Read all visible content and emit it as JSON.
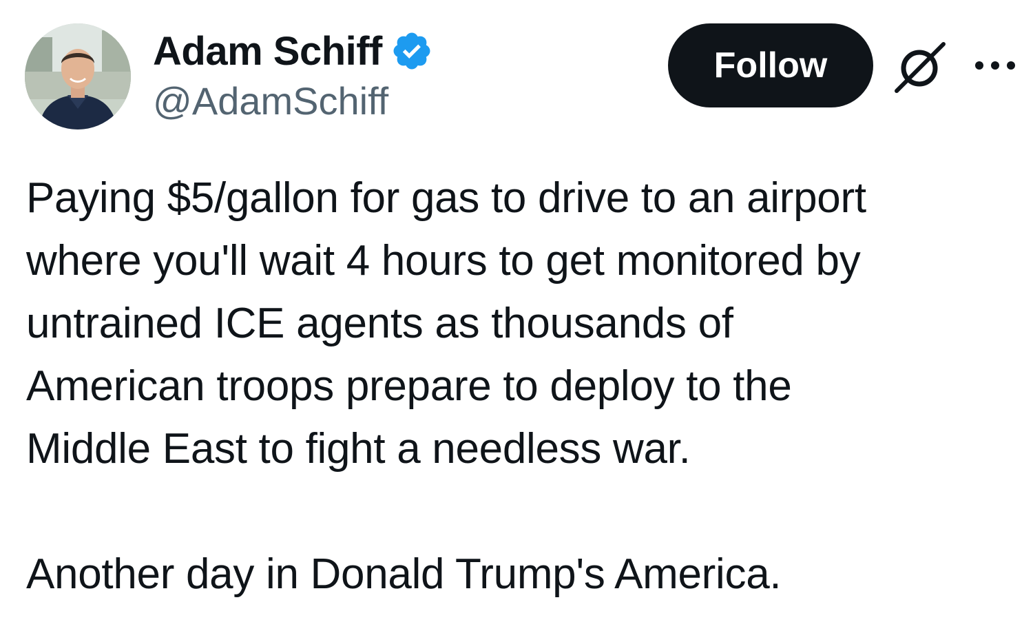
{
  "author": {
    "display_name": "Adam Schiff",
    "handle": "@AdamSchiff",
    "verified": true,
    "verified_color": "#1d9bf0",
    "avatar_icon": "profile-photo"
  },
  "actions": {
    "follow_label": "Follow",
    "follow_bg": "#0f1419",
    "grok_icon": "grok-icon",
    "more_icon": "more-horizontal-icon"
  },
  "tweet": {
    "body_lines": "Paying $5/gallon for gas to drive to an airport\nwhere you'll wait 4 hours to get monitored by\nuntrained ICE agents as thousands of\nAmerican troops prepare to deploy to the\nMiddle East to fight a needless war.",
    "closing": "Another day in Donald Trump's America."
  }
}
